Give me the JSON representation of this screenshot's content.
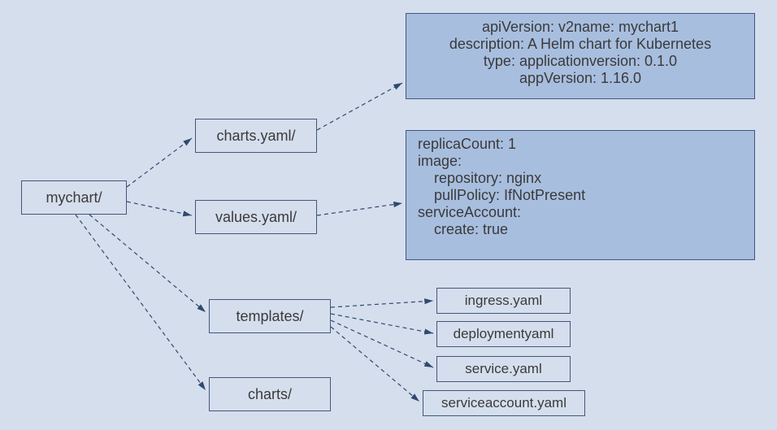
{
  "root": {
    "label": "mychart/"
  },
  "children": {
    "charts_yaml": "charts.yaml/",
    "values_yaml": "values.yaml/",
    "templates": "templates/",
    "charts_dir": "charts/"
  },
  "details": {
    "chart_yaml": {
      "line1": "apiVersion: v2name: mychart1",
      "line2": "description: A Helm chart for Kubernetes",
      "line3": "type: applicationversion: 0.1.0",
      "line4": "appVersion: 1.16.0"
    },
    "values_yaml": {
      "line1": "replicaCount: 1",
      "line2": "image:",
      "line3": "    repository: nginx",
      "line4": "    pullPolicy: IfNotPresent",
      "line5": "serviceAccount:",
      "line6": "    create: true"
    }
  },
  "templates_files": {
    "ingress": "ingress.yaml",
    "deployment": "deploymentyaml",
    "service": "service.yaml",
    "serviceaccount": "serviceaccount.yaml"
  }
}
